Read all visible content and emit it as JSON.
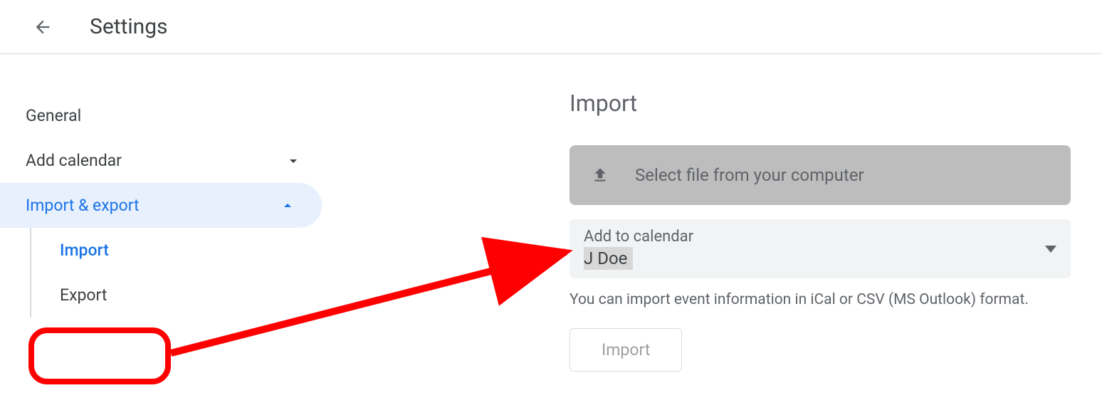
{
  "header": {
    "title": "Settings"
  },
  "sidebar": {
    "general": "General",
    "add_calendar": "Add calendar",
    "import_export": "Import & export",
    "subitems": {
      "import": "Import",
      "export": "Export"
    }
  },
  "main": {
    "section_title": "Import",
    "file_select_label": "Select file from your computer",
    "calendar_label": "Add to calendar",
    "calendar_value": "J Doe",
    "helper_text": "You can import event information in iCal or CSV (MS Outlook) format.",
    "import_button": "Import"
  }
}
